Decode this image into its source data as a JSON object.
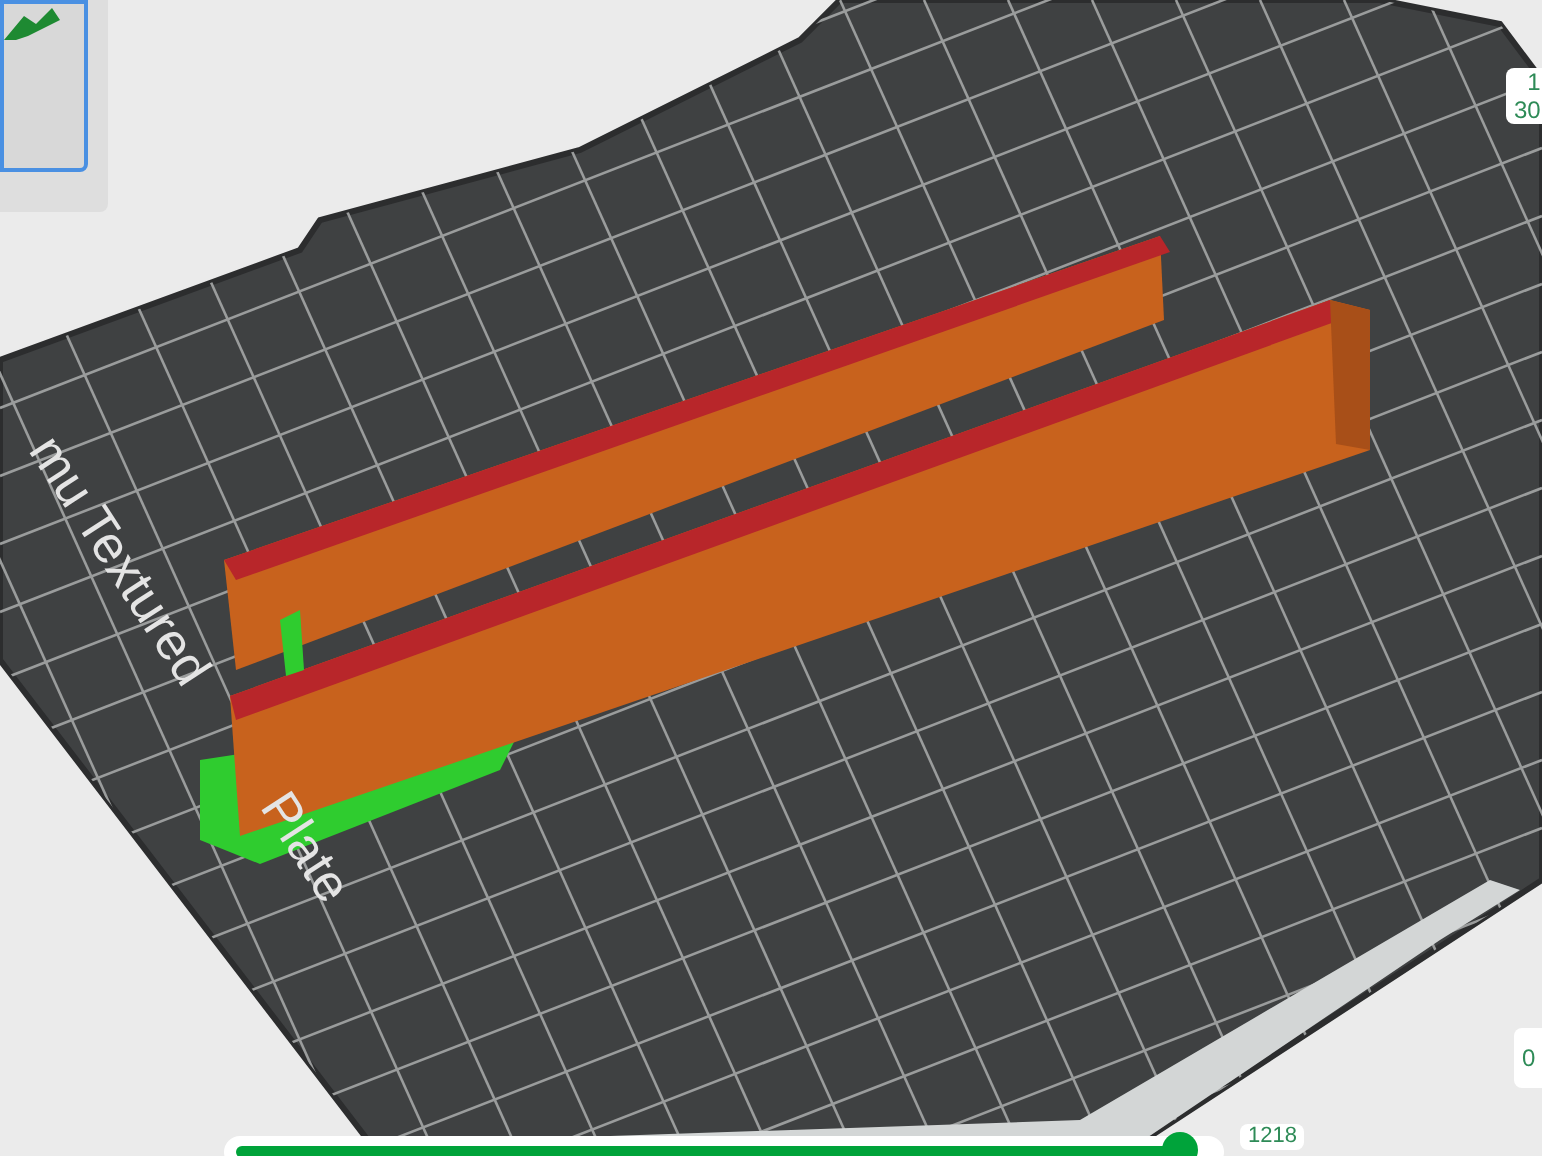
{
  "plate_thumbnail": {
    "selected": true
  },
  "bed_label": [
    "mu Textured",
    "Plate"
  ],
  "layer_slider": {
    "top_label": [
      "1",
      "30"
    ],
    "bottom_label": "0"
  },
  "move_slider": {
    "level": 0.99,
    "label": "1218"
  }
}
